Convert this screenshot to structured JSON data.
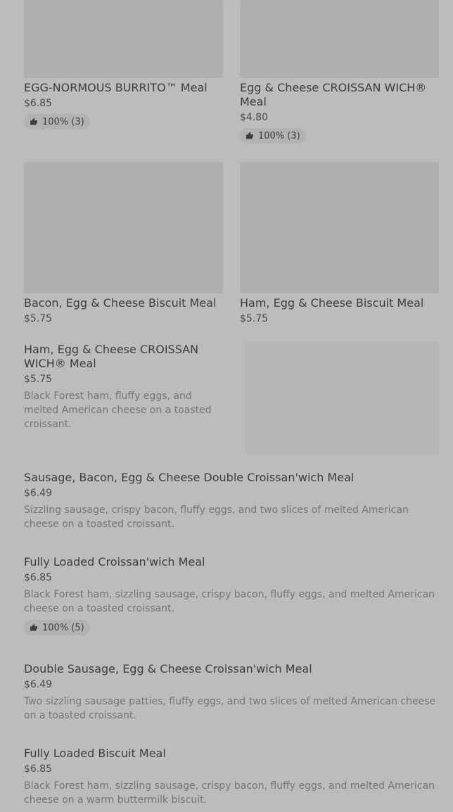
{
  "grid_items": [
    {
      "title": "EGG-NORMOUS BURRITO™ Meal",
      "price": "$6.85",
      "rating": "100% (3)"
    },
    {
      "title": "Egg & Cheese CROISSAN WICH® Meal",
      "price": "$4.80",
      "rating": "100% (3)"
    },
    {
      "title": "Bacon, Egg & Cheese Biscuit Meal",
      "price": "$5.75"
    },
    {
      "title": "Ham, Egg & Cheese Biscuit Meal",
      "price": "$5.75"
    }
  ],
  "featured_item": {
    "title": "Ham, Egg & Cheese CROISSAN WICH® Meal",
    "price": "$5.75",
    "description": "Black Forest ham, fluffy eggs, and melted American cheese on a toasted croissant."
  },
  "list_items": [
    {
      "title": "Sausage, Bacon, Egg & Cheese Double Croissan'wich Meal",
      "price": "$6.49",
      "description": "Sizzling sausage, crispy bacon, fluffy eggs, and two slices of melted American cheese on a toasted croissant."
    },
    {
      "title": "Fully Loaded Croissan'wich Meal",
      "price": "$6.85",
      "description": "Black Forest ham, sizzling sausage, crispy bacon, fluffy eggs, and melted American cheese on a toasted croissant.",
      "rating": "100% (5)"
    },
    {
      "title": "Double Sausage, Egg & Cheese Croissan'wich Meal",
      "price": "$6.49",
      "description": "Two sizzling sausage patties, fluffy eggs, and two slices of melted American cheese on a toasted croissant."
    },
    {
      "title": "Fully Loaded Biscuit Meal",
      "price": "$6.85",
      "description": "Black Forest ham, sizzling sausage, crispy bacon, fluffy eggs, and melted American cheese on a warm buttermilk biscuit."
    }
  ],
  "icons": {
    "rating": "thumbs-up-icon"
  },
  "colors": {
    "overlay_background": "#bcbcbc",
    "image_placeholder": "#afafaf",
    "rating_chip": "#b2b2b2"
  }
}
